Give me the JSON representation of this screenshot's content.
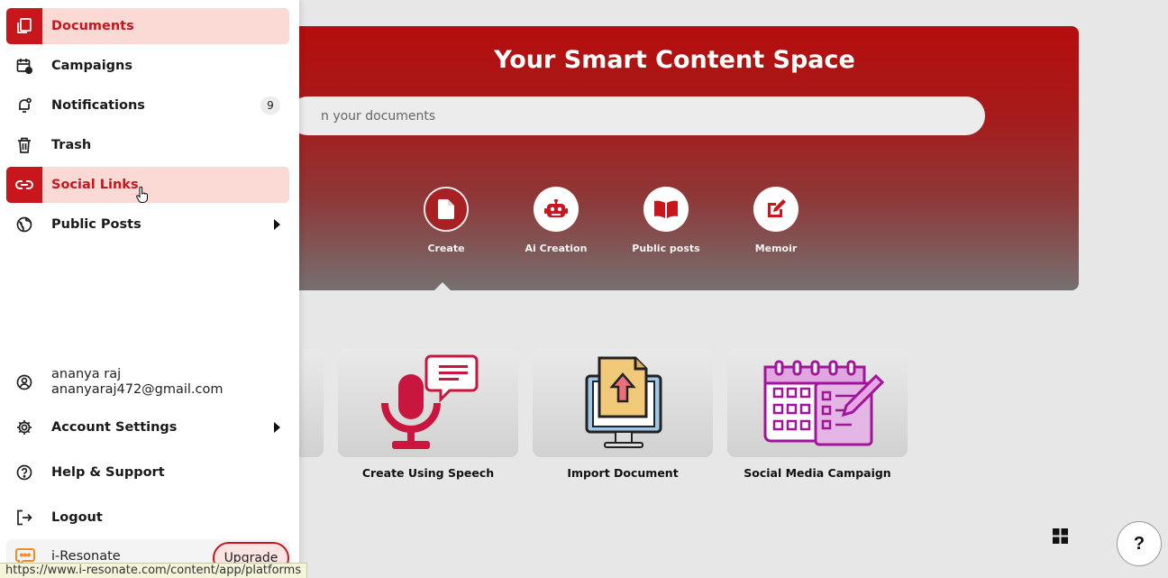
{
  "sidebar": {
    "items": [
      {
        "label": "Documents",
        "icon": "documents-icon",
        "active": true
      },
      {
        "label": "Campaigns",
        "icon": "calendar-clock-icon"
      },
      {
        "label": "Notifications",
        "icon": "bell-icon",
        "badge": "9"
      },
      {
        "label": "Trash",
        "icon": "trash-icon"
      },
      {
        "label": "Social Links",
        "icon": "link-icon",
        "active": true
      },
      {
        "label": "Public Posts",
        "icon": "globe-icon"
      }
    ],
    "user": {
      "name": "ananya raj",
      "email": "ananyaraj472@gmail.com"
    },
    "bottom_items": [
      {
        "label": "Account Settings",
        "icon": "gear-icon"
      },
      {
        "label": "Help & Support",
        "icon": "help-circle-icon"
      },
      {
        "label": "Logout",
        "icon": "logout-icon"
      }
    ],
    "promo": {
      "name": "i-Resonate",
      "upgrade_label": "Upgrade"
    }
  },
  "status_url": "https://www.i-resonate.com/content/app/platforms",
  "hero": {
    "title": "Your Smart Content Space",
    "search_placeholder": "n your documents",
    "actions": [
      {
        "label": "Create",
        "icon": "file-icon"
      },
      {
        "label": "Ai Creation",
        "icon": "robot-icon"
      },
      {
        "label": "Public posts",
        "icon": "book-icon"
      },
      {
        "label": "Memoir",
        "icon": "edit-icon"
      }
    ]
  },
  "cards": [
    {
      "label": "Create Using Speech",
      "icon": "microphone-speech-icon"
    },
    {
      "label": "Import Document",
      "icon": "import-document-icon"
    },
    {
      "label": "Social Media Campaign",
      "icon": "campaign-calendar-icon"
    }
  ],
  "help_label": "?",
  "colors": {
    "accent": "#c8161d",
    "active_bg": "#fbd9d4",
    "page_bg": "#e7e7e7"
  }
}
